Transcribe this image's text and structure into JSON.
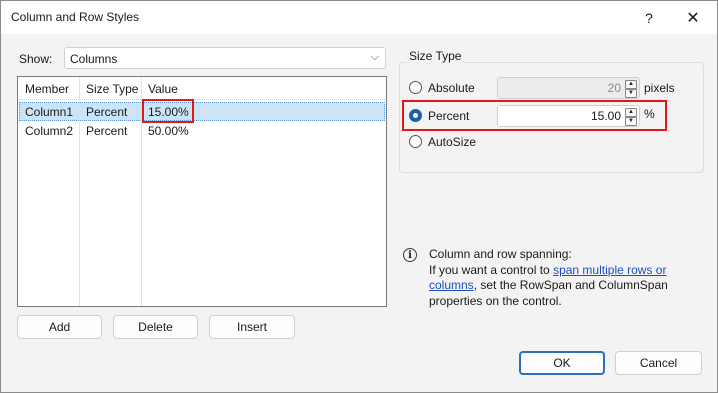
{
  "window": {
    "title": "Column and Row Styles",
    "help": "?",
    "close": "✕"
  },
  "show": {
    "label": "Show:",
    "value": "Columns"
  },
  "grid": {
    "headers": [
      "Member",
      "Size Type",
      "Value"
    ],
    "rows": [
      {
        "member": "Column1",
        "size_type": "Percent",
        "value": "15.00%"
      },
      {
        "member": "Column2",
        "size_type": "Percent",
        "value": "50.00%"
      }
    ]
  },
  "buttons": {
    "add": "Add",
    "delete": "Delete",
    "insert": "Insert",
    "ok": "OK",
    "cancel": "Cancel"
  },
  "size_type": {
    "label": "Size Type",
    "absolute": {
      "label": "Absolute",
      "value": "20",
      "unit": "pixels"
    },
    "percent": {
      "label": "Percent",
      "value": "15.00",
      "unit": "%"
    },
    "autosize": {
      "label": "AutoSize"
    }
  },
  "info": {
    "title": "Column and row spanning:",
    "text_before": "If you want a control to ",
    "link": "span multiple rows or columns",
    "text_after": ", set the RowSpan and ColumnSpan properties on the control."
  },
  "colors": {
    "highlight": "#e0181b",
    "selection": "#cce4f7",
    "accent": "#1f5fa8"
  }
}
